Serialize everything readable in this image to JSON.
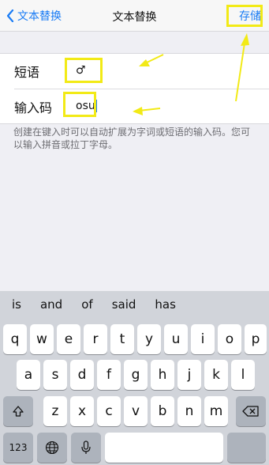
{
  "navbar": {
    "back_label": "文本替换",
    "title": "文本替换",
    "save_label": "存储"
  },
  "form": {
    "phrase_label": "短语",
    "phrase_value": "♂",
    "shortcut_label": "输入码",
    "shortcut_value": "osu"
  },
  "help_text": "创建在键入时可以自动扩展为字词或短语的输入码。您可以输入拼音或拉丁字母。",
  "suggestions": [
    "is",
    "and",
    "of",
    "said",
    "has"
  ],
  "keyboard": {
    "row1": [
      "q",
      "w",
      "e",
      "r",
      "t",
      "y",
      "u",
      "i",
      "o",
      "p"
    ],
    "row2": [
      "a",
      "s",
      "d",
      "f",
      "g",
      "h",
      "j",
      "k",
      "l"
    ],
    "row3": [
      "z",
      "x",
      "c",
      "v",
      "b",
      "n",
      "m"
    ],
    "numbers_key": "123",
    "icons": [
      "shift-icon",
      "backspace-icon",
      "globe-icon",
      "microphone-icon"
    ]
  },
  "colors": {
    "accent": "#1a7cf5",
    "annotation_yellow": "#f2ea16",
    "background": "#efeff4",
    "keyboard_bg": "#d1d4da"
  }
}
